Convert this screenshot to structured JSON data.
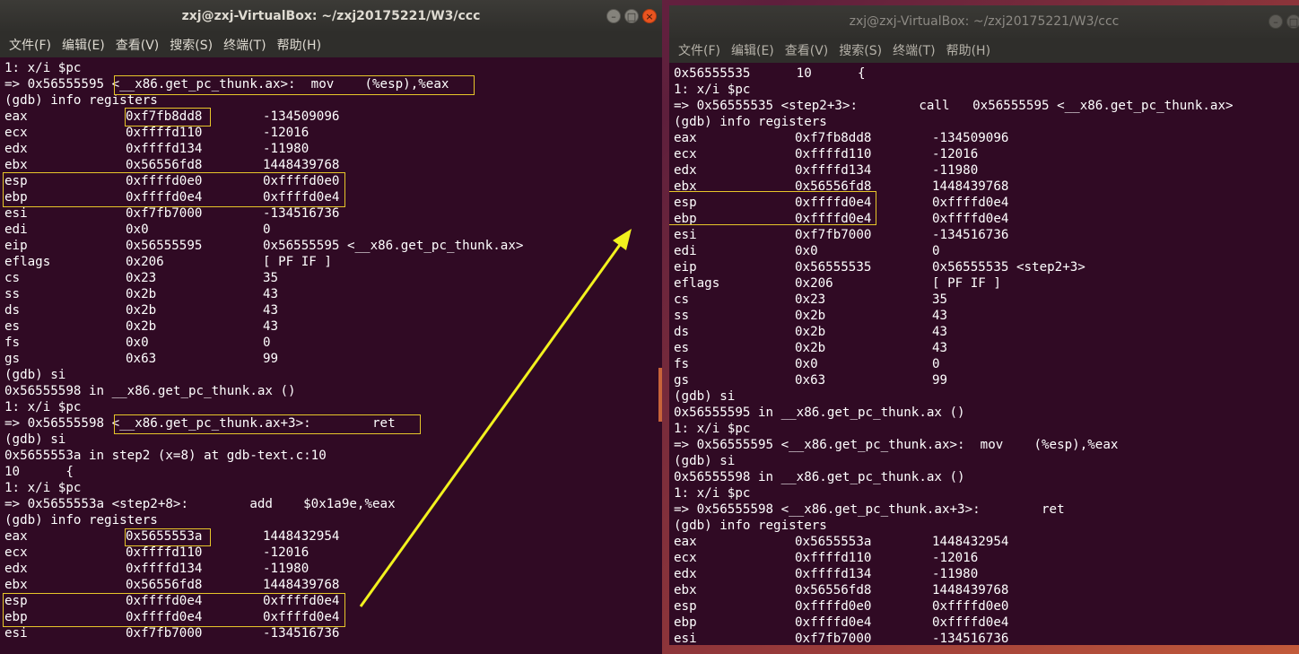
{
  "left_window": {
    "title": "zxj@zxj-VirtualBox: ~/zxj20175221/W3/ccc",
    "menu": [
      "文件(F)",
      "编辑(E)",
      "查看(V)",
      "搜索(S)",
      "终端(T)",
      "帮助(H)"
    ],
    "lines": [
      "1: x/i $pc",
      "=> 0x56555595 <__x86.get_pc_thunk.ax>:  mov    (%esp),%eax",
      "(gdb) info registers",
      [
        "eax",
        "0xf7fb8dd8",
        "-134509096"
      ],
      [
        "ecx",
        "0xffffd110",
        "-12016"
      ],
      [
        "edx",
        "0xffffd134",
        "-11980"
      ],
      [
        "ebx",
        "0x56556fd8",
        "1448439768"
      ],
      [
        "esp",
        "0xffffd0e0",
        "0xffffd0e0"
      ],
      [
        "ebp",
        "0xffffd0e4",
        "0xffffd0e4"
      ],
      [
        "esi",
        "0xf7fb7000",
        "-134516736"
      ],
      [
        "edi",
        "0x0",
        "0"
      ],
      [
        "eip",
        "0x56555595",
        "0x56555595 <__x86.get_pc_thunk.ax>"
      ],
      [
        "eflags",
        "0x206",
        "[ PF IF ]"
      ],
      [
        "cs",
        "0x23",
        "35"
      ],
      [
        "ss",
        "0x2b",
        "43"
      ],
      [
        "ds",
        "0x2b",
        "43"
      ],
      [
        "es",
        "0x2b",
        "43"
      ],
      [
        "fs",
        "0x0",
        "0"
      ],
      [
        "gs",
        "0x63",
        "99"
      ],
      "(gdb) si",
      "0x56555598 in __x86.get_pc_thunk.ax ()",
      "1: x/i $pc",
      "=> 0x56555598 <__x86.get_pc_thunk.ax+3>:        ret",
      "(gdb) si",
      "0x5655553a in step2 (x=8) at gdb-text.c:10",
      "10      {",
      "1: x/i $pc",
      "=> 0x5655553a <step2+8>:        add    $0x1a9e,%eax",
      "(gdb) info registers",
      [
        "eax",
        "0x5655553a",
        "1448432954"
      ],
      [
        "ecx",
        "0xffffd110",
        "-12016"
      ],
      [
        "edx",
        "0xffffd134",
        "-11980"
      ],
      [
        "ebx",
        "0x56556fd8",
        "1448439768"
      ],
      [
        "esp",
        "0xffffd0e4",
        "0xffffd0e4"
      ],
      [
        "ebp",
        "0xffffd0e4",
        "0xffffd0e4"
      ],
      [
        "esi",
        "0xf7fb7000",
        "-134516736"
      ]
    ]
  },
  "right_window": {
    "title": "zxj@zxj-VirtualBox: ~/zxj20175221/W3/ccc",
    "menu": [
      "文件(F)",
      "编辑(E)",
      "查看(V)",
      "搜索(S)",
      "终端(T)",
      "帮助(H)"
    ],
    "lines": [
      "0x56555535      10      {",
      "1: x/i $pc",
      "=> 0x56555535 <step2+3>:        call   0x56555595 <__x86.get_pc_thunk.ax>",
      "(gdb) info registers",
      [
        "eax",
        "0xf7fb8dd8",
        "-134509096"
      ],
      [
        "ecx",
        "0xffffd110",
        "-12016"
      ],
      [
        "edx",
        "0xffffd134",
        "-11980"
      ],
      [
        "ebx",
        "0x56556fd8",
        "1448439768"
      ],
      [
        "esp",
        "0xffffd0e4",
        "0xffffd0e4"
      ],
      [
        "ebp",
        "0xffffd0e4",
        "0xffffd0e4"
      ],
      [
        "esi",
        "0xf7fb7000",
        "-134516736"
      ],
      [
        "edi",
        "0x0",
        "0"
      ],
      [
        "eip",
        "0x56555535",
        "0x56555535 <step2+3>"
      ],
      [
        "eflags",
        "0x206",
        "[ PF IF ]"
      ],
      [
        "cs",
        "0x23",
        "35"
      ],
      [
        "ss",
        "0x2b",
        "43"
      ],
      [
        "ds",
        "0x2b",
        "43"
      ],
      [
        "es",
        "0x2b",
        "43"
      ],
      [
        "fs",
        "0x0",
        "0"
      ],
      [
        "gs",
        "0x63",
        "99"
      ],
      "(gdb) si",
      "0x56555595 in __x86.get_pc_thunk.ax ()",
      "1: x/i $pc",
      "=> 0x56555595 <__x86.get_pc_thunk.ax>:  mov    (%esp),%eax",
      "(gdb) si",
      "0x56555598 in __x86.get_pc_thunk.ax ()",
      "1: x/i $pc",
      "=> 0x56555598 <__x86.get_pc_thunk.ax+3>:        ret",
      "(gdb) info registers",
      [
        "eax",
        "0x5655553a",
        "1448432954"
      ],
      [
        "ecx",
        "0xffffd110",
        "-12016"
      ],
      [
        "edx",
        "0xffffd134",
        "-11980"
      ],
      [
        "ebx",
        "0x56556fd8",
        "1448439768"
      ],
      [
        "esp",
        "0xffffd0e0",
        "0xffffd0e0"
      ],
      [
        "ebp",
        "0xffffd0e4",
        "0xffffd0e4"
      ],
      [
        "esi",
        "0xf7fb7000",
        "-134516736"
      ]
    ]
  },
  "colors": {
    "terminal_bg": "#300a24",
    "highlight": "#e7c62a",
    "arrow": "#f2f21e"
  }
}
